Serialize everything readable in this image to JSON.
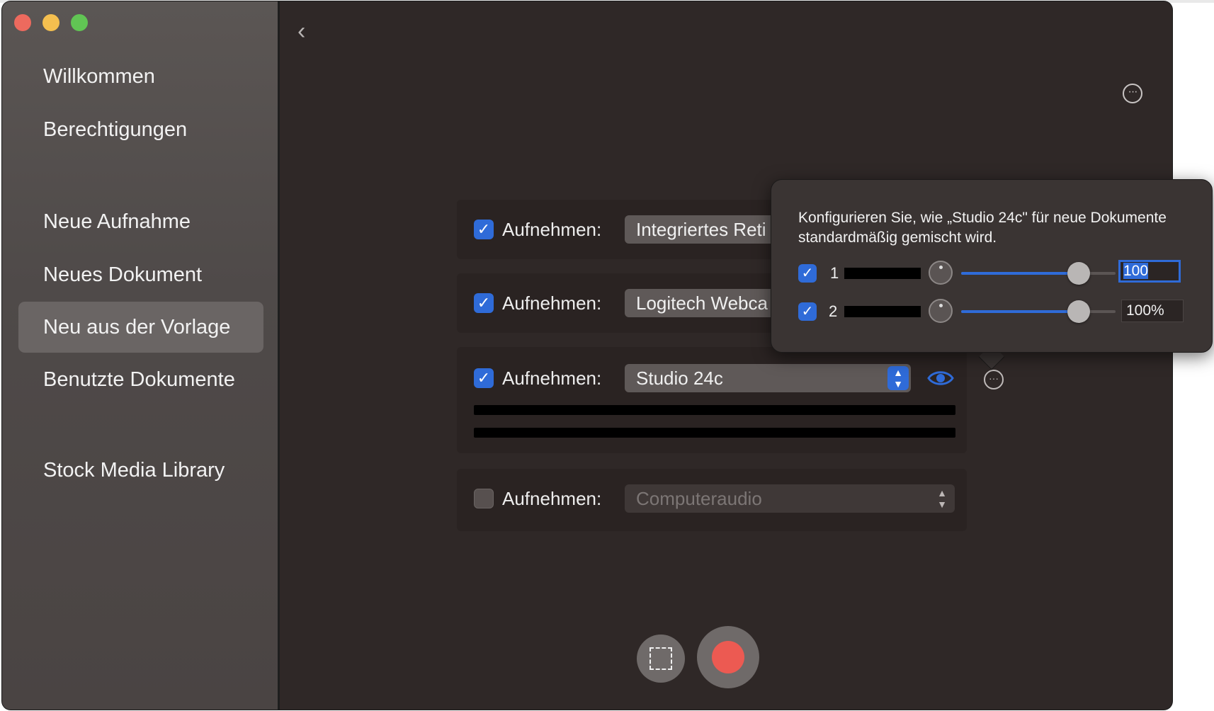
{
  "sidebar": {
    "items": [
      {
        "label": "Willkommen"
      },
      {
        "label": "Berechtigungen"
      },
      {
        "label": "Neue Aufnahme"
      },
      {
        "label": "Neues Dokument"
      },
      {
        "label": "Neu aus der Vorlage",
        "selected": true
      },
      {
        "label": "Benutzte Dokumente"
      },
      {
        "label": "Stock Media Library"
      }
    ]
  },
  "sources": [
    {
      "label": "Aufnehmen:",
      "device": "Integriertes Reti",
      "checked": true
    },
    {
      "label": "Aufnehmen:",
      "device": "Logitech Webca",
      "checked": true
    },
    {
      "label": "Aufnehmen:",
      "device": "Studio 24c",
      "checked": true
    },
    {
      "label": "Aufnehmen:",
      "device": "Computeraudio",
      "checked": false
    }
  ],
  "popover": {
    "description": "Konfigurieren Sie, wie „Studio 24c\" für neue Dokumente standardmäßig gemischt wird.",
    "channels": [
      {
        "number": "1",
        "checked": true,
        "volume_text": "100",
        "volume_level": 0.76
      },
      {
        "number": "2",
        "checked": true,
        "volume_text": "100%",
        "volume_level": 0.76
      }
    ]
  },
  "icons": {
    "back": "chevron-left-icon",
    "more": "ellipsis-circle-icon",
    "eye": "eye-icon",
    "select_area": "dashed-rectangle-icon",
    "record": "record-icon"
  },
  "colors": {
    "accent": "#2f6bd8",
    "record": "#ec5a52"
  }
}
